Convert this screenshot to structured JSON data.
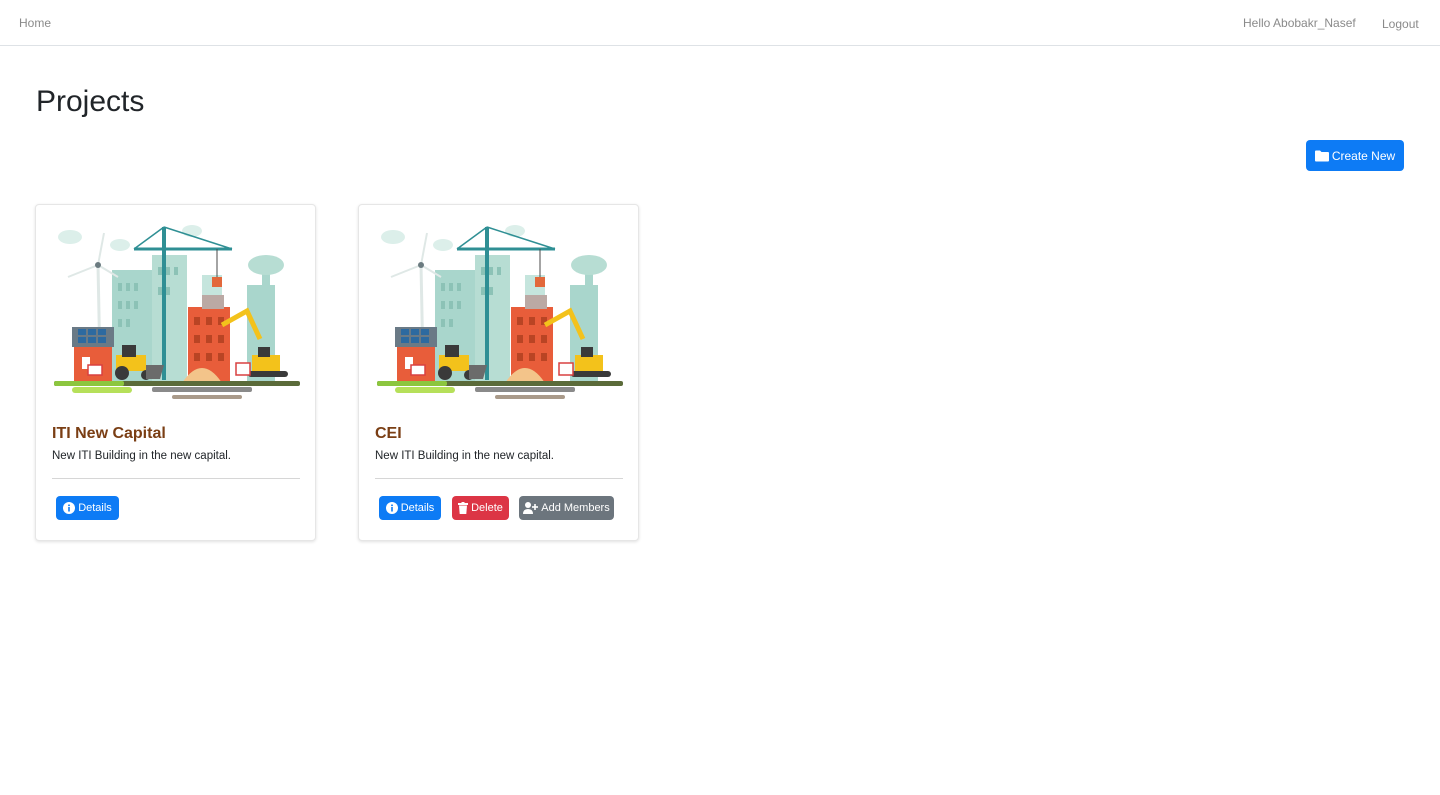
{
  "nav": {
    "home": "Home",
    "greeting": "Hello Abobakr_Nasef",
    "logout": "Logout"
  },
  "page": {
    "title": "Projects"
  },
  "toolbar": {
    "create_label": "Create New",
    "create_icon": "folder-icon"
  },
  "colors": {
    "primary": "#0d7bf5",
    "danger": "#dc3545",
    "secondary": "#6c757d",
    "card_title": "#7a3e14"
  },
  "projects": [
    {
      "name": "ITI New Capital",
      "description": "New ITI Building in the new capital.",
      "image": "construction-illustration",
      "actions": {
        "details": "Details"
      }
    },
    {
      "name": "CEI",
      "description": "New ITI Building in the new capital.",
      "image": "construction-illustration",
      "actions": {
        "details": "Details",
        "delete": "Delete",
        "add_members": "Add Members"
      }
    }
  ]
}
